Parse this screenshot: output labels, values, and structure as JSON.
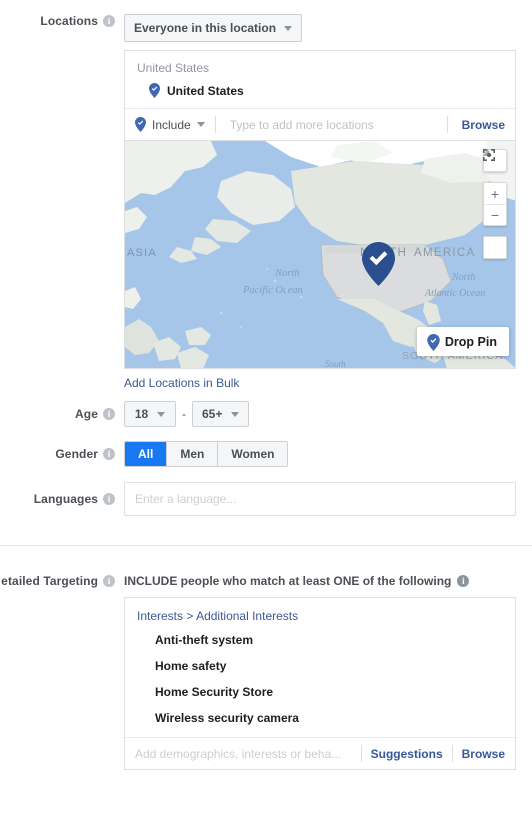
{
  "locations": {
    "label": "Locations",
    "info_icon": "info-icon",
    "scope_dropdown": {
      "value": "Everyone in this location",
      "caret_icon": "chevron-down-icon"
    },
    "panel": {
      "group_header": "United States",
      "selected_items": [
        {
          "pin_icon": "location-pin-check-icon",
          "label": "United States"
        }
      ],
      "include_dropdown": {
        "pin_icon": "location-pin-check-icon",
        "value": "Include",
        "caret_icon": "chevron-down-icon"
      },
      "search_placeholder": "Type to add more locations",
      "search_value": "",
      "browse_label": "Browse"
    },
    "map": {
      "labels": [
        "ASIA",
        "NORTH AMERICA",
        "North Pacific Ocean",
        "North Atlantic Ocean",
        "SOUTH AMERICA",
        "South"
      ],
      "controls": {
        "pan_up_icon": "triangle-up-icon",
        "zoom_in_label": "+",
        "zoom_out_label": "−",
        "fullscreen_icon": "fullscreen-icon"
      },
      "pin_icon": "map-marker-check-icon",
      "drop_pin": {
        "icon": "location-pin-check-icon",
        "label": "Drop Pin"
      },
      "colors": {
        "water": "#a5c6e9",
        "land": "#eef0ec",
        "country_fill": "#dadcdd",
        "pin": "#2b4e8f"
      }
    },
    "bulk_link": "Add Locations in Bulk"
  },
  "age": {
    "label": "Age",
    "info_icon": "info-icon",
    "min": "18",
    "max": "65+",
    "separator": "-",
    "caret_icon": "chevron-down-icon"
  },
  "gender": {
    "label": "Gender",
    "info_icon": "info-icon",
    "options": [
      "All",
      "Men",
      "Women"
    ],
    "selected": "All",
    "active_color": "#1778f2"
  },
  "languages": {
    "label": "Languages",
    "info_icon": "info-icon",
    "placeholder": "Enter a language...",
    "value": ""
  },
  "detailed_targeting": {
    "label": "etailed Targeting",
    "info_icon": "info-icon",
    "include_heading": "INCLUDE people who match at least ONE of the following",
    "include_heading_info_icon": "info-icon",
    "breadcrumb": {
      "root": "Interests",
      "separator": ">",
      "child": "Additional Interests"
    },
    "interests": [
      "Anti-theft system",
      "Home safety",
      "Home Security Store",
      "Wireless security camera"
    ],
    "input_placeholder": "Add demographics, interests or beha...",
    "input_value": "",
    "suggestions_label": "Suggestions",
    "browse_label": "Browse"
  }
}
